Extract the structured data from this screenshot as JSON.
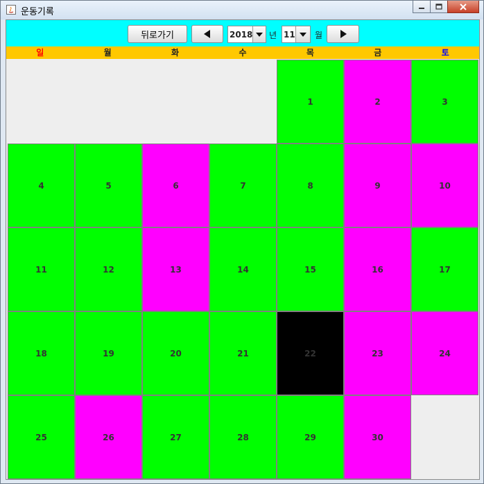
{
  "window": {
    "title": "운동기록"
  },
  "toolbar": {
    "back_label": "뒤로가기",
    "year_value": "2018",
    "year_unit": "년",
    "month_value": "11",
    "month_unit": "월"
  },
  "weekdays": [
    "일",
    "월",
    "화",
    "수",
    "목",
    "금",
    "토"
  ],
  "colors": {
    "toolbar_bg": "#00ffff",
    "weekday_bg": "#ffc800",
    "exercised": "#00ff00",
    "not_exercised": "#ff00ff",
    "today": "#000000",
    "empty": "#eeeeee"
  },
  "calendar": {
    "year": 2018,
    "month": 11,
    "leading_blanks": 4,
    "trailing_blanks": 1,
    "days": [
      {
        "label": "1",
        "status": "exercised"
      },
      {
        "label": "2",
        "status": "not_exercised"
      },
      {
        "label": "3",
        "status": "exercised"
      },
      {
        "label": "4",
        "status": "exercised"
      },
      {
        "label": "5",
        "status": "exercised"
      },
      {
        "label": "6",
        "status": "not_exercised"
      },
      {
        "label": "7",
        "status": "exercised"
      },
      {
        "label": "8",
        "status": "exercised"
      },
      {
        "label": "9",
        "status": "not_exercised"
      },
      {
        "label": "10",
        "status": "not_exercised"
      },
      {
        "label": "11",
        "status": "exercised"
      },
      {
        "label": "12",
        "status": "exercised"
      },
      {
        "label": "13",
        "status": "not_exercised"
      },
      {
        "label": "14",
        "status": "exercised"
      },
      {
        "label": "15",
        "status": "exercised"
      },
      {
        "label": "16",
        "status": "not_exercised"
      },
      {
        "label": "17",
        "status": "exercised"
      },
      {
        "label": "18",
        "status": "exercised"
      },
      {
        "label": "19",
        "status": "exercised"
      },
      {
        "label": "20",
        "status": "exercised"
      },
      {
        "label": "21",
        "status": "exercised"
      },
      {
        "label": "22",
        "status": "today"
      },
      {
        "label": "23",
        "status": "not_exercised"
      },
      {
        "label": "24",
        "status": "not_exercised"
      },
      {
        "label": "25",
        "status": "exercised"
      },
      {
        "label": "26",
        "status": "not_exercised"
      },
      {
        "label": "27",
        "status": "exercised"
      },
      {
        "label": "28",
        "status": "exercised"
      },
      {
        "label": "29",
        "status": "exercised"
      },
      {
        "label": "30",
        "status": "not_exercised"
      }
    ]
  }
}
